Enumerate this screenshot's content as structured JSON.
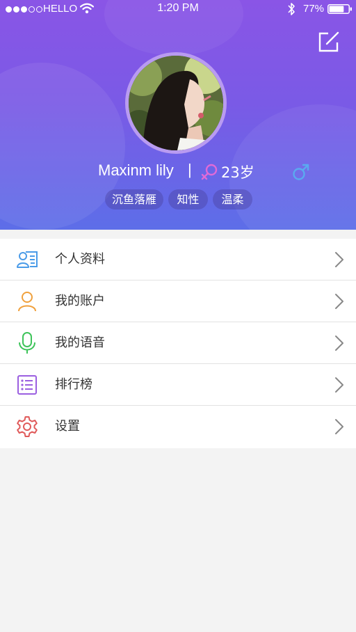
{
  "status_bar": {
    "carrier": "HELLO",
    "time": "1:20 PM",
    "battery": "77%",
    "battery_level": 0.77,
    "signal_bars_filled": 3,
    "signal_bars_total": 5
  },
  "profile": {
    "name": "Maxinm lily",
    "separator": "|",
    "age": "23岁",
    "tags": [
      "沉鱼落雁",
      "知性",
      "温柔"
    ]
  },
  "menu": {
    "items": [
      {
        "label": "个人资料",
        "icon": "profile-card-icon",
        "color": "#4a9be8"
      },
      {
        "label": "我的账户",
        "icon": "user-icon",
        "color": "#f0a03c"
      },
      {
        "label": "我的语音",
        "icon": "microphone-icon",
        "color": "#3ec45a"
      },
      {
        "label": "排行榜",
        "icon": "list-icon",
        "color": "#9b5fe0"
      },
      {
        "label": "设置",
        "icon": "gear-icon",
        "color": "#e05a5a"
      }
    ]
  },
  "colors": {
    "header_top": "#8a55e6",
    "header_bottom": "#5d6ee8",
    "avatar_ring": "#b99bf1",
    "female_symbol": "#e06ad8",
    "male_symbol": "#5aaaf0",
    "background": "#f3f3f3"
  }
}
